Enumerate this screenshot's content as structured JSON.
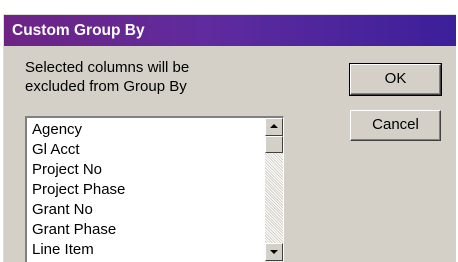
{
  "window": {
    "title": "Custom Group By"
  },
  "description": {
    "line1": "Selected columns will be",
    "line2": "excluded from Group By"
  },
  "list": {
    "items": [
      "Agency",
      "Gl Acct",
      "Project No",
      "Project Phase",
      "Grant No",
      "Grant Phase",
      "Line Item"
    ]
  },
  "buttons": {
    "ok": "OK",
    "cancel": "Cancel"
  }
}
